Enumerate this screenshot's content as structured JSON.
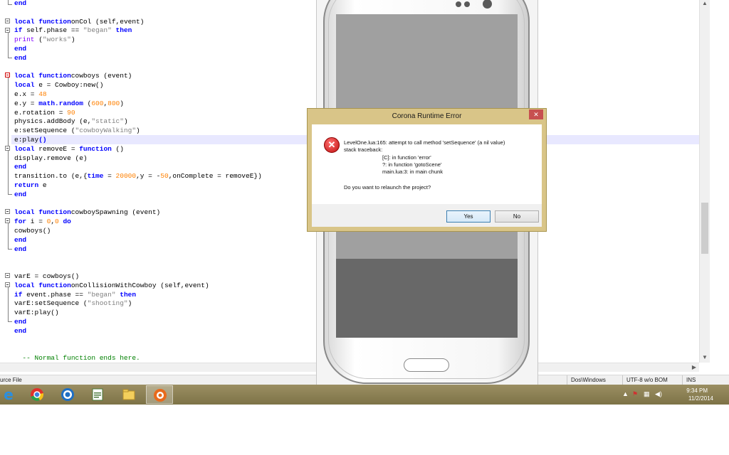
{
  "editor": {
    "lines": [
      {
        "t": [
          [
            "kw",
            "end"
          ]
        ]
      },
      {
        "t": []
      },
      {
        "t": [
          [
            "kw",
            "local function"
          ],
          [
            "",
            "onCol (self,event)"
          ]
        ]
      },
      {
        "t": [
          [
            "kw",
            "if"
          ],
          [
            "",
            " self.phase == "
          ],
          [
            "str",
            "\"began\""
          ],
          [
            "",
            " "
          ],
          [
            "kw",
            "then"
          ]
        ]
      },
      {
        "t": [
          [
            "fn",
            "print"
          ],
          [
            "",
            " ("
          ],
          [
            "str",
            "\"works\""
          ],
          [
            "",
            ")"
          ]
        ]
      },
      {
        "t": [
          [
            "kw",
            "end"
          ]
        ]
      },
      {
        "t": [
          [
            "kw",
            "end"
          ]
        ]
      },
      {
        "t": []
      },
      {
        "t": [
          [
            "kw",
            "local function"
          ],
          [
            "",
            "cowboys (event)"
          ]
        ]
      },
      {
        "t": [
          [
            "kw",
            "local"
          ],
          [
            "",
            " e = Cowboy:new()"
          ]
        ]
      },
      {
        "t": [
          [
            "",
            "e.x = "
          ],
          [
            "num",
            "48"
          ]
        ]
      },
      {
        "t": [
          [
            "",
            "e.y = "
          ],
          [
            "kw",
            "math.random"
          ],
          [
            "",
            " ("
          ],
          [
            "num",
            "600"
          ],
          [
            "",
            ","
          ],
          [
            "num",
            "800"
          ],
          [
            "",
            ")"
          ]
        ]
      },
      {
        "t": [
          [
            "",
            "e.rotation = "
          ],
          [
            "num",
            "90"
          ]
        ]
      },
      {
        "t": [
          [
            "",
            "physics.addBody (e,"
          ],
          [
            "str",
            "\"static\""
          ],
          [
            "",
            ")"
          ]
        ]
      },
      {
        "t": [
          [
            "",
            "e:setSequence ("
          ],
          [
            "str",
            "\"cowboyWalking\""
          ],
          [
            "",
            ")"
          ]
        ]
      },
      {
        "t": [
          [
            "",
            "e:play"
          ],
          [
            "kw",
            "()"
          ]
        ]
      },
      {
        "t": [
          [
            "kw",
            "local"
          ],
          [
            "",
            " removeE = "
          ],
          [
            "kw",
            "function"
          ],
          [
            "",
            " ()"
          ]
        ]
      },
      {
        "t": [
          [
            "",
            "display.remove (e)"
          ]
        ]
      },
      {
        "t": [
          [
            "kw",
            "end"
          ]
        ]
      },
      {
        "t": [
          [
            "",
            "transition.to (e,{"
          ],
          [
            "kw",
            "time"
          ],
          [
            "",
            " = "
          ],
          [
            "num",
            "20000"
          ],
          [
            "",
            ",y = -"
          ],
          [
            "num",
            "50"
          ],
          [
            "",
            ",onComplete = removeE})"
          ]
        ]
      },
      {
        "t": [
          [
            "kw",
            "return"
          ],
          [
            "",
            " e"
          ]
        ]
      },
      {
        "t": [
          [
            "kw",
            "end"
          ]
        ]
      },
      {
        "t": []
      },
      {
        "t": [
          [
            "kw",
            "local function"
          ],
          [
            "",
            "cowboySpawning (event)"
          ]
        ]
      },
      {
        "t": [
          [
            "kw",
            "for"
          ],
          [
            "",
            " i = "
          ],
          [
            "num",
            "0"
          ],
          [
            "",
            ","
          ],
          [
            "num",
            "0"
          ],
          [
            "",
            " "
          ],
          [
            "kw",
            "do"
          ]
        ]
      },
      {
        "t": [
          [
            "",
            "cowboys()"
          ]
        ]
      },
      {
        "t": [
          [
            "kw",
            "end"
          ]
        ]
      },
      {
        "t": [
          [
            "kw",
            "end"
          ]
        ]
      },
      {
        "t": []
      },
      {
        "t": []
      },
      {
        "t": [
          [
            "",
            "varE = cowboys()"
          ]
        ]
      },
      {
        "t": [
          [
            "kw",
            "local function"
          ],
          [
            "",
            "onCollisionWithCowboy (self,event)"
          ]
        ]
      },
      {
        "t": [
          [
            "kw",
            "if"
          ],
          [
            "",
            " event.phase == "
          ],
          [
            "str",
            "\"began\""
          ],
          [
            "",
            " "
          ],
          [
            "kw",
            "then"
          ]
        ]
      },
      {
        "t": [
          [
            "",
            "varE:setSequence ("
          ],
          [
            "str",
            "\"shooting\""
          ],
          [
            "",
            ")"
          ]
        ]
      },
      {
        "t": [
          [
            "",
            "varE:play()"
          ]
        ]
      },
      {
        "t": [
          [
            "kw",
            "end"
          ]
        ]
      },
      {
        "t": [
          [
            "kw",
            "end"
          ]
        ]
      },
      {
        "t": []
      },
      {
        "t": []
      },
      {
        "t": [
          [
            "cmt",
            "  -- Normal function ends here."
          ]
        ]
      }
    ],
    "highlighted_line": 15
  },
  "statusbar": {
    "file_type": "urce File",
    "eol": "Dos\\Windows",
    "encoding": "UTF-8 w/o BOM",
    "mode": "INS"
  },
  "dialog": {
    "title": "Corona Runtime Error",
    "close_glyph": "✕",
    "error_glyph": "✕",
    "message": "LevelOne.lua:165: attempt to call method 'setSequence' (a nil value)",
    "traceback_header": "stack traceback:",
    "traceback": [
      "[C]: in function 'error'",
      "?: in function 'gotoScene'",
      "main.lua:3: in main chunk"
    ],
    "question": "Do you want to relaunch the project?",
    "yes_label": "Yes",
    "no_label": "No"
  },
  "taskbar": {
    "apps": [
      "internet-explorer",
      "chrome",
      "corona-ide",
      "editor",
      "file-explorer",
      "corona-simulator"
    ],
    "active_app": "corona-simulator",
    "time": "9:34 PM",
    "date": "11/2/2014",
    "tray_flag": "⚑",
    "tray_network": "▦",
    "tray_volume": "◀)",
    "tray_up": "▲"
  }
}
